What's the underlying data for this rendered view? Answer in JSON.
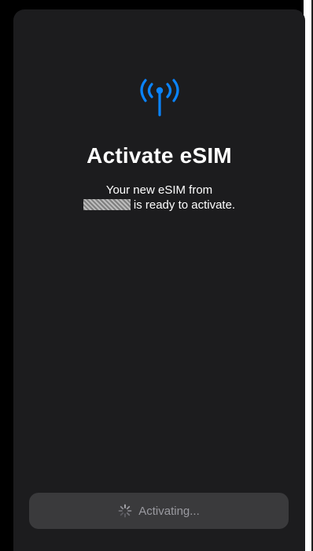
{
  "sheet": {
    "title": "Activate eSIM",
    "subtitle_line1": "Your new eSIM from",
    "subtitle_line2": "is ready to activate.",
    "icon": "antenna-signal-icon",
    "accent_color": "#0a84ff"
  },
  "button": {
    "label": "Activating...",
    "icon": "spinner-icon",
    "state": "disabled"
  }
}
